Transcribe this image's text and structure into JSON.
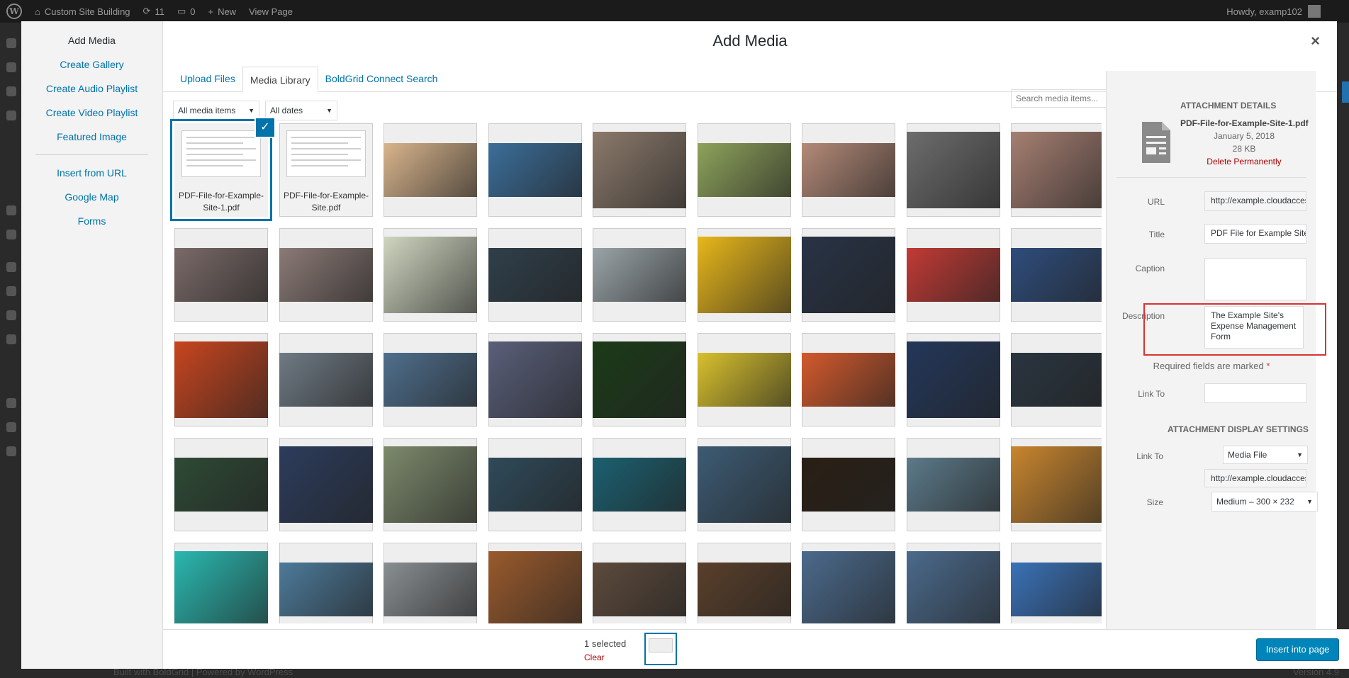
{
  "admin_bar": {
    "site_name": "Custom Site Building",
    "updates_count": "11",
    "comments_count": "0",
    "new_label": "New",
    "view_label": "View Page",
    "howdy": "Howdy, examp102"
  },
  "behind": {
    "footer": "Built with BoldGrid | Powered by WordPress",
    "version": "Version 4.9"
  },
  "menu": {
    "items": [
      "Add Media",
      "Create Gallery",
      "Create Audio Playlist",
      "Create Video Playlist",
      "Featured Image"
    ],
    "items2": [
      "Insert from URL",
      "Google Map",
      "Forms"
    ]
  },
  "frame": {
    "title": "Add Media",
    "close": "×"
  },
  "tabs": [
    "Upload Files",
    "Media Library",
    "BoldGrid Connect Search"
  ],
  "filters": {
    "type": "All media items",
    "date": "All dates",
    "search_placeholder": "Search media items..."
  },
  "files": {
    "file1": "PDF-File-for-Example-Site-1.pdf",
    "file2": "PDF-File-for-Example-Site.pdf"
  },
  "tile_colors": [
    [
      "#d9b58d",
      "#3b6e9a",
      "#8c7a6b",
      "#8ea35b",
      "#b48a78",
      "#6d6d6d",
      "#a67f72"
    ],
    [
      "#7a6a68",
      "#8b7a76",
      "#cfd6c0",
      "#2f3f4a",
      "#9aa4a8",
      "#e8b71a",
      "#283346",
      "#c23a35",
      "#2e4d7c"
    ],
    [
      "#c8451f",
      "#6f7a84",
      "#4f6f8d",
      "#5a5f7a",
      "#1b3b18",
      "#d8c12d",
      "#d35a2c",
      "#23375a",
      "#2a3540"
    ],
    [
      "#2e4a35",
      "#2c3c5c",
      "#7d8a6c",
      "#2f4a5a",
      "#1b6070",
      "#3d5b74",
      "#2a1f14",
      "#5c7a8a",
      "#c9862e"
    ],
    [
      "#2ab8b0",
      "#4d7a9a",
      "#8a8f92",
      "#9a5a2c",
      "#5d4a3c",
      "#5a3f2a",
      "#4b6a8c",
      "#4b6a8c",
      "#3a72b8"
    ]
  ],
  "sidebar": {
    "heading": "Attachment Details",
    "filename": "PDF-File-for-Example-Site-1.pdf",
    "date": "January 5, 2018",
    "size": "28 KB",
    "delete": "Delete Permanently",
    "url_label": "URL",
    "url_value": "http://example.cloudaccess.host/wp-content/uploads/",
    "title_label": "Title",
    "title_value": "PDF File for Example Site",
    "caption_label": "Caption",
    "caption_value": "",
    "description_label": "Description",
    "description_value": "The Example Site's Expense Management Form",
    "required_note": "Required fields are marked",
    "required_star": "*",
    "linkto_label": "Link To",
    "linkto_value": "",
    "display_heading": "Attachment Display Settings",
    "display_linkto_label": "Link To",
    "display_linkto_value": "Media File",
    "display_url_value": "http://example.cloudaccess.host/wp-content/",
    "size_label": "Size",
    "size_value": "Medium – 300 × 232"
  },
  "bottom": {
    "selected_count": "1 selected",
    "clear": "Clear",
    "insert": "Insert into page"
  },
  "colors": {
    "accent": "#0073aa",
    "danger": "#dc3232"
  }
}
